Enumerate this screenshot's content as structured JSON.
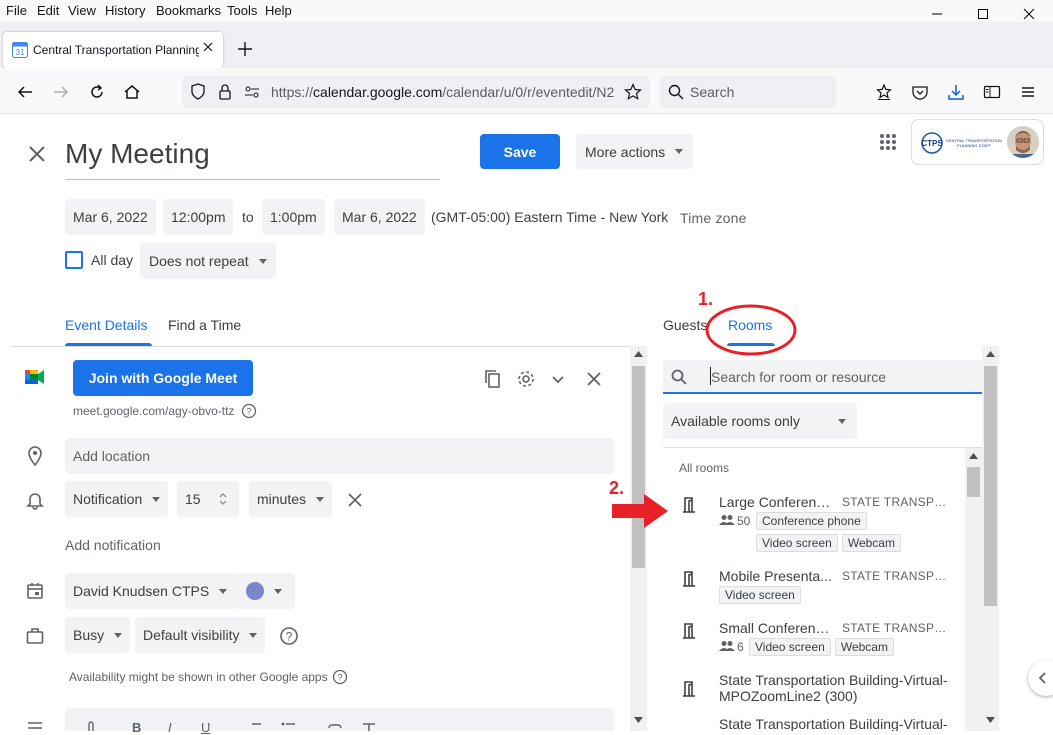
{
  "browser": {
    "menus": [
      "File",
      "Edit",
      "View",
      "History",
      "Bookmarks",
      "Tools",
      "Help"
    ],
    "tab_title": "Central Transportation Planning",
    "url": "https://calendar.google.com/calendar/u/0/r/eventedit/N2",
    "url_host_bold": "calendar.google.com",
    "search_placeholder": "Search"
  },
  "event": {
    "title": "My Meeting",
    "save_label": "Save",
    "more_actions_label": "More actions",
    "start_date": "Mar 6, 2022",
    "start_time": "12:00pm",
    "to_label": "to",
    "end_time": "1:00pm",
    "end_date": "Mar 6, 2022",
    "timezone": "(GMT-05:00) Eastern Time - New York",
    "timezone_link": "Time zone",
    "all_day_label": "All day",
    "repeat": "Does not repeat"
  },
  "tabs": {
    "event_details": "Event Details",
    "find_time": "Find a Time"
  },
  "details": {
    "meet_button": "Join with Google Meet",
    "meet_link": "meet.google.com/agy-obvo-ttz",
    "location_placeholder": "Add location",
    "notification_type": "Notification",
    "notification_value": "15",
    "notification_unit": "minutes",
    "add_notification": "Add notification",
    "calendar_owner": "David Knudsen CTPS",
    "status": "Busy",
    "visibility": "Default visibility",
    "availability_note": "Availability might be shown in other Google apps"
  },
  "right_panel": {
    "guests_tab": "Guests",
    "rooms_tab": "Rooms",
    "search_placeholder": "Search for room or resource",
    "filter": "Available rooms only",
    "all_rooms_label": "All rooms",
    "rooms": [
      {
        "name": "Large Conferenc...",
        "building": "STATE TRANSPOR...",
        "capacity": "50",
        "features": [
          "Conference phone",
          "Video screen",
          "Webcam"
        ]
      },
      {
        "name": "Mobile Presenta...",
        "building": "STATE TRANSPOR...",
        "capacity": "",
        "features": [
          "Video screen"
        ]
      },
      {
        "name": "Small Conferenc...",
        "building": "STATE TRANSPOR...",
        "capacity": "6",
        "features": [
          "Video screen",
          "Webcam"
        ]
      },
      {
        "name_line1": "State Transportation Building-Virtual-",
        "name_line2": "MPOZoomLine2 (300)"
      },
      {
        "name_line1": "State Transportation Building-Virtual-"
      }
    ]
  },
  "annotations": {
    "step1": "1.",
    "step2": "2."
  },
  "colors": {
    "accent": "#1a73e8",
    "annotation_red": "#e8202a",
    "event_color": "#7986cb"
  }
}
